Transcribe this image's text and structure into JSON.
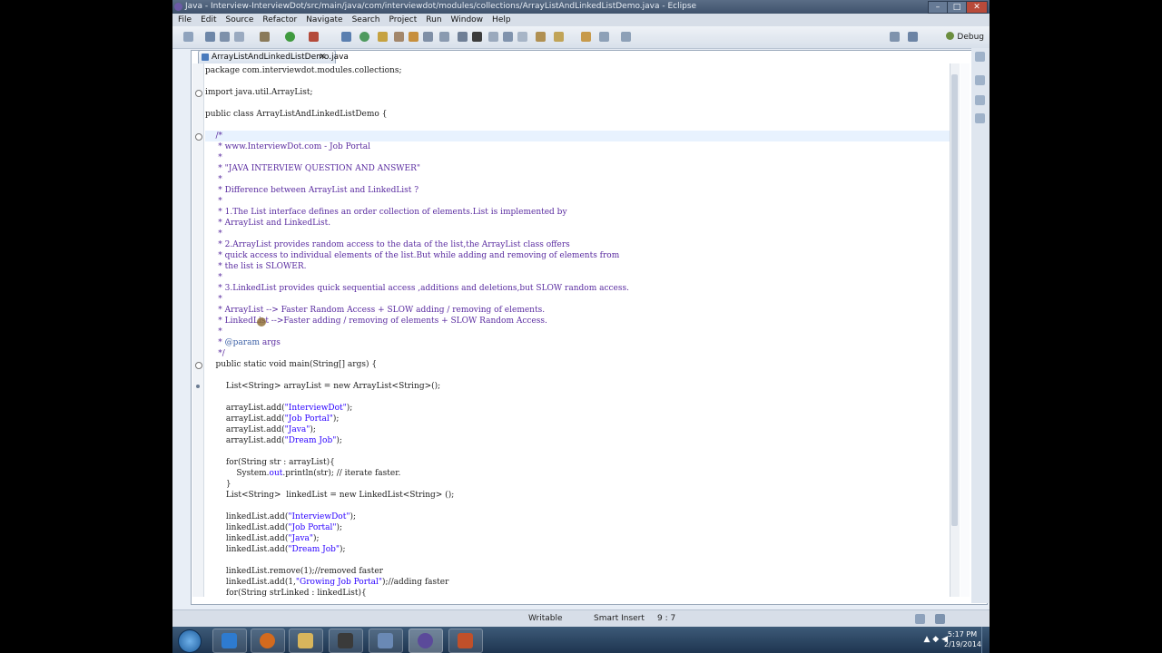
{
  "window": {
    "title": "Java - Interview-InterviewDot/src/main/java/com/interviewdot/modules/collections/ArrayListAndLinkedListDemo.java - Eclipse",
    "controls": {
      "minimize": "–",
      "maximize": "□",
      "close": "✕"
    }
  },
  "menubar": {
    "items": [
      "File",
      "Edit",
      "Source",
      "Refactor",
      "Navigate",
      "Search",
      "Project",
      "Run",
      "Window",
      "Help"
    ]
  },
  "toolbar": {
    "perspective_label": "Debug"
  },
  "editor": {
    "tab_label": "ArrayListAndLinkedListDemo.java",
    "tab_close": "✕",
    "lines": [
      {
        "segments": [
          {
            "t": "package com.interviewdot.modules.collections;",
            "cls": ""
          }
        ]
      },
      {
        "segments": [
          {
            "t": "",
            "cls": ""
          }
        ]
      },
      {
        "segments": [
          {
            "t": "import java.util.ArrayList;",
            "cls": ""
          }
        ]
      },
      {
        "segments": [
          {
            "t": "",
            "cls": ""
          }
        ]
      },
      {
        "segments": [
          {
            "t": "public class ArrayListAndLinkedListDemo {",
            "cls": ""
          }
        ]
      },
      {
        "segments": [
          {
            "t": "",
            "cls": ""
          }
        ]
      },
      {
        "segments": [
          {
            "t": "    /*",
            "cls": "c"
          }
        ]
      },
      {
        "segments": [
          {
            "t": "     * www.InterviewDot.com - Job Portal",
            "cls": "c"
          }
        ]
      },
      {
        "segments": [
          {
            "t": "     *",
            "cls": "c"
          }
        ]
      },
      {
        "segments": [
          {
            "t": "     * \"JAVA INTERVIEW QUESTION AND ANSWER\"",
            "cls": "c"
          }
        ]
      },
      {
        "segments": [
          {
            "t": "     *",
            "cls": "c"
          }
        ]
      },
      {
        "segments": [
          {
            "t": "     * Difference between ArrayList and LinkedList ?",
            "cls": "c"
          }
        ]
      },
      {
        "segments": [
          {
            "t": "     *",
            "cls": "c"
          }
        ]
      },
      {
        "segments": [
          {
            "t": "     * 1.The List interface defines an order collection of elements.List is implemented by",
            "cls": "c"
          }
        ]
      },
      {
        "segments": [
          {
            "t": "     * ArrayList and LinkedList.",
            "cls": "c"
          }
        ]
      },
      {
        "segments": [
          {
            "t": "     *",
            "cls": "c"
          }
        ]
      },
      {
        "segments": [
          {
            "t": "     * 2.ArrayList provides random access to the data of the list,the ArrayList class offers",
            "cls": "c"
          }
        ]
      },
      {
        "segments": [
          {
            "t": "     * quick access to individual elements of the list.But while adding and removing of elements from",
            "cls": "c"
          }
        ]
      },
      {
        "segments": [
          {
            "t": "     * the list is SLOWER.",
            "cls": "c"
          }
        ]
      },
      {
        "segments": [
          {
            "t": "     *",
            "cls": "c"
          }
        ]
      },
      {
        "segments": [
          {
            "t": "     * 3.LinkedList provides quick sequential access ,additions and deletions,but SLOW random access.",
            "cls": "c"
          }
        ]
      },
      {
        "segments": [
          {
            "t": "     *",
            "cls": "c"
          }
        ]
      },
      {
        "segments": [
          {
            "t": "     * ArrayList --> Faster Random Access + SLOW adding / removing of elements.",
            "cls": "c"
          }
        ]
      },
      {
        "segments": [
          {
            "t": "     * LinkedList -->Faster adding / removing of elements + SLOW Random Access.",
            "cls": "c"
          }
        ]
      },
      {
        "segments": [
          {
            "t": "     *",
            "cls": "c"
          }
        ]
      },
      {
        "segments": [
          {
            "t": "     * ",
            "cls": "c"
          },
          {
            "t": "@param",
            "cls": "p"
          },
          {
            "t": " args",
            "cls": "c"
          }
        ]
      },
      {
        "segments": [
          {
            "t": "     */",
            "cls": "c"
          }
        ]
      },
      {
        "segments": [
          {
            "t": "    public static void main(String[] args) {",
            "cls": ""
          }
        ]
      },
      {
        "segments": [
          {
            "t": "",
            "cls": ""
          }
        ]
      },
      {
        "segments": [
          {
            "t": "        List<String> arrayList = new ArrayList<String>();",
            "cls": ""
          }
        ]
      },
      {
        "segments": [
          {
            "t": "",
            "cls": ""
          }
        ]
      },
      {
        "segments": [
          {
            "t": "        arrayList.add(",
            "cls": ""
          },
          {
            "t": "\"InterviewDot\"",
            "cls": "s"
          },
          {
            "t": ");",
            "cls": ""
          }
        ]
      },
      {
        "segments": [
          {
            "t": "        arrayList.add(",
            "cls": ""
          },
          {
            "t": "\"Job Portal\"",
            "cls": "s"
          },
          {
            "t": ");",
            "cls": ""
          }
        ]
      },
      {
        "segments": [
          {
            "t": "        arrayList.add(",
            "cls": ""
          },
          {
            "t": "\"Java\"",
            "cls": "s"
          },
          {
            "t": ");",
            "cls": ""
          }
        ]
      },
      {
        "segments": [
          {
            "t": "        arrayList.add(",
            "cls": ""
          },
          {
            "t": "\"Dream Job\"",
            "cls": "s"
          },
          {
            "t": ");",
            "cls": ""
          }
        ]
      },
      {
        "segments": [
          {
            "t": "",
            "cls": ""
          }
        ]
      },
      {
        "segments": [
          {
            "t": "        for(String str : arrayList){",
            "cls": ""
          }
        ]
      },
      {
        "segments": [
          {
            "t": "            System.",
            "cls": ""
          },
          {
            "t": "out",
            "cls": "s"
          },
          {
            "t": ".println(str); // iterate faster.",
            "cls": ""
          }
        ]
      },
      {
        "segments": [
          {
            "t": "        }",
            "cls": ""
          }
        ]
      },
      {
        "segments": [
          {
            "t": "        List<String>  linkedList = new LinkedList<String> ();",
            "cls": ""
          }
        ]
      },
      {
        "segments": [
          {
            "t": "",
            "cls": ""
          }
        ]
      },
      {
        "segments": [
          {
            "t": "        linkedList.add(",
            "cls": ""
          },
          {
            "t": "\"InterviewDot\"",
            "cls": "s"
          },
          {
            "t": ");",
            "cls": ""
          }
        ]
      },
      {
        "segments": [
          {
            "t": "        linkedList.add(",
            "cls": ""
          },
          {
            "t": "\"Job Portal\"",
            "cls": "s"
          },
          {
            "t": ");",
            "cls": ""
          }
        ]
      },
      {
        "segments": [
          {
            "t": "        linkedList.add(",
            "cls": ""
          },
          {
            "t": "\"Java\"",
            "cls": "s"
          },
          {
            "t": ");",
            "cls": ""
          }
        ]
      },
      {
        "segments": [
          {
            "t": "        linkedList.add(",
            "cls": ""
          },
          {
            "t": "\"Dream Job\"",
            "cls": "s"
          },
          {
            "t": ");",
            "cls": ""
          }
        ]
      },
      {
        "segments": [
          {
            "t": "",
            "cls": ""
          }
        ]
      },
      {
        "segments": [
          {
            "t": "        linkedList.remove(1);//removed faster",
            "cls": ""
          }
        ]
      },
      {
        "segments": [
          {
            "t": "        linkedList.add(1,",
            "cls": ""
          },
          {
            "t": "\"Growing Job Portal\"",
            "cls": "s"
          },
          {
            "t": ");//adding faster",
            "cls": ""
          }
        ]
      },
      {
        "segments": [
          {
            "t": "        for(String strLinked : linkedList){",
            "cls": ""
          }
        ]
      }
    ]
  },
  "statusbar": {
    "writable": "Writable",
    "insert_mode": "Smart Insert",
    "position": "9 : 7"
  },
  "taskbar": {
    "clock_time": "5:17 PM",
    "clock_date": "2/19/2014"
  },
  "colors": {
    "comment": "#5a2ca0",
    "string": "#2a00ff",
    "current_line": "#e8f2fe"
  }
}
